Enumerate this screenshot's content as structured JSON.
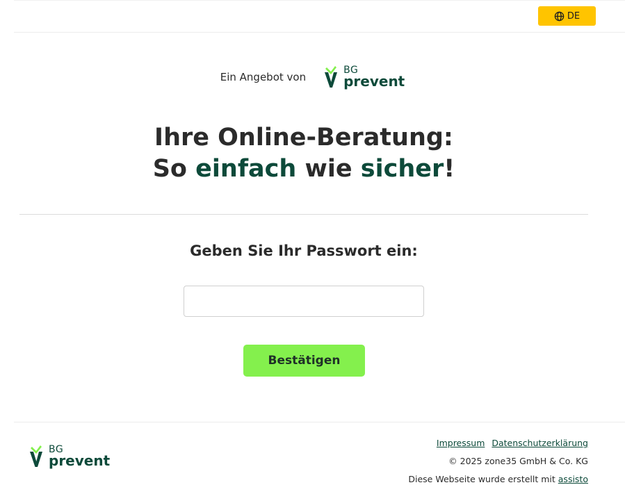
{
  "header": {
    "language_label": "DE",
    "language_icon": "globe-icon",
    "accent_color": "#ffc400"
  },
  "brand": {
    "offer_text": "Ein Angebot von",
    "logo_small": "BG",
    "logo_large": "prevent",
    "logo_color": "#0d4a3a",
    "logo_accent": "#84f04d"
  },
  "hero": {
    "line1": "Ihre Online-Beratung:",
    "line2_part1": "So ",
    "line2_accent1": "einfach",
    "line2_part2": " wie ",
    "line2_accent2": "sicher",
    "line2_end": "!"
  },
  "form": {
    "prompt": "Geben Sie Ihr Passwort ein:",
    "password_value": "",
    "password_placeholder": "",
    "submit_label": "Bestätigen",
    "submit_color": "#84f04d"
  },
  "footer": {
    "logo_small": "BG",
    "logo_large": "prevent",
    "link_imprint": "Impressum",
    "link_privacy": "Datenschutzerklärung",
    "copyright": "© 2025 zone35 GmbH & Co. KG",
    "credit_text": "Diese Webseite wurde erstellt mit ",
    "credit_link": "assisto"
  }
}
